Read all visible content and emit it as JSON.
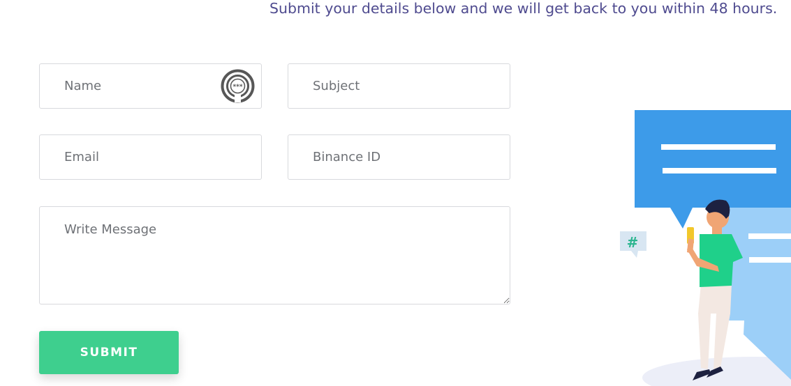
{
  "header": {
    "subtitle": "Submit your details below and we will get back to you within 48 hours."
  },
  "form": {
    "name": {
      "placeholder": "Name",
      "value": ""
    },
    "subject": {
      "placeholder": "Subject",
      "value": ""
    },
    "email": {
      "placeholder": "Email",
      "value": ""
    },
    "binance_id": {
      "placeholder": "Binance ID",
      "value": ""
    },
    "message": {
      "placeholder": "Write Message",
      "value": ""
    },
    "password_manager_icon": "password-manager-icon",
    "submit_label": "SUBMIT"
  },
  "illustration": {
    "hashtag": "#",
    "description_icon": "person-chat-illustration"
  },
  "colors": {
    "accent": "#3ecf8e",
    "subtitle": "#4f4b8f",
    "bubble_blue": "#3d9be9",
    "bubble_light": "#9ccff8",
    "shirt": "#1fd08a"
  }
}
